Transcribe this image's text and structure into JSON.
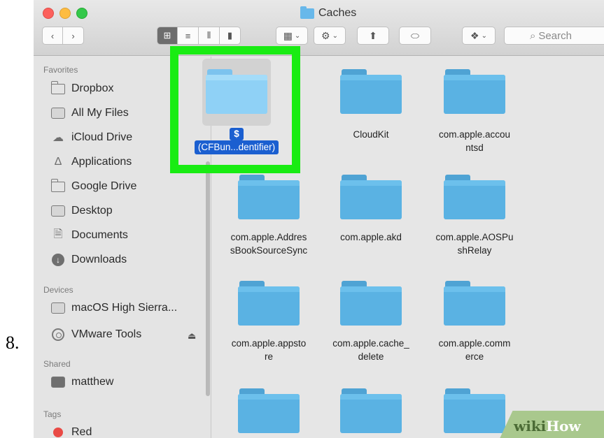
{
  "step": {
    "number": "8."
  },
  "window": {
    "title": "Caches",
    "traffic_lights": [
      "close",
      "minimize",
      "zoom"
    ]
  },
  "toolbar": {
    "back_icon": "chevron-left-icon",
    "forward_icon": "chevron-right-icon",
    "view_modes": [
      "icon-view",
      "list-view",
      "column-view",
      "cover-flow-view"
    ],
    "active_view": "icon-view",
    "search_placeholder": "Search"
  },
  "sidebar": {
    "favorites_header": "Favorites",
    "favorites": [
      {
        "label": "Dropbox",
        "icon": "folder-icon"
      },
      {
        "label": "All My Files",
        "icon": "all-files-icon"
      },
      {
        "label": "iCloud Drive",
        "icon": "cloud-icon"
      },
      {
        "label": "Applications",
        "icon": "applications-icon"
      },
      {
        "label": "Google Drive",
        "icon": "folder-icon"
      },
      {
        "label": "Desktop",
        "icon": "desktop-icon"
      },
      {
        "label": "Documents",
        "icon": "documents-icon"
      },
      {
        "label": "Downloads",
        "icon": "downloads-icon"
      }
    ],
    "devices_header": "Devices",
    "devices": [
      {
        "label": "macOS High Sierra...",
        "icon": "disk-icon"
      },
      {
        "label": "VMware Tools",
        "icon": "disc-icon",
        "eject": "⏏"
      }
    ],
    "shared_header": "Shared",
    "shared": [
      {
        "label": "matthew",
        "icon": "computer-icon"
      }
    ],
    "tags_header": "Tags",
    "tags": [
      {
        "label": "Red",
        "color": "#e94a45"
      }
    ]
  },
  "content": {
    "selected_item": {
      "line1": "$",
      "line2": "(CFBun...dentifier)"
    },
    "items": [
      {
        "label": "CloudKit"
      },
      {
        "label": "com.apple.accou\nntsd"
      },
      {
        "label": "com.apple.Addres\nsBookSourceSync"
      },
      {
        "label": "com.apple.akd"
      },
      {
        "label": "com.apple.AOSPu\nshRelay"
      },
      {
        "label": "com.apple.appsto\nre"
      },
      {
        "label": "com.apple.cache_\ndelete"
      },
      {
        "label": "com.apple.comm\nerce"
      }
    ],
    "highlight_color": "#19ec13",
    "selection_color": "#1b5fd0"
  },
  "watermark": {
    "part1": "wiki",
    "part2": "How"
  }
}
